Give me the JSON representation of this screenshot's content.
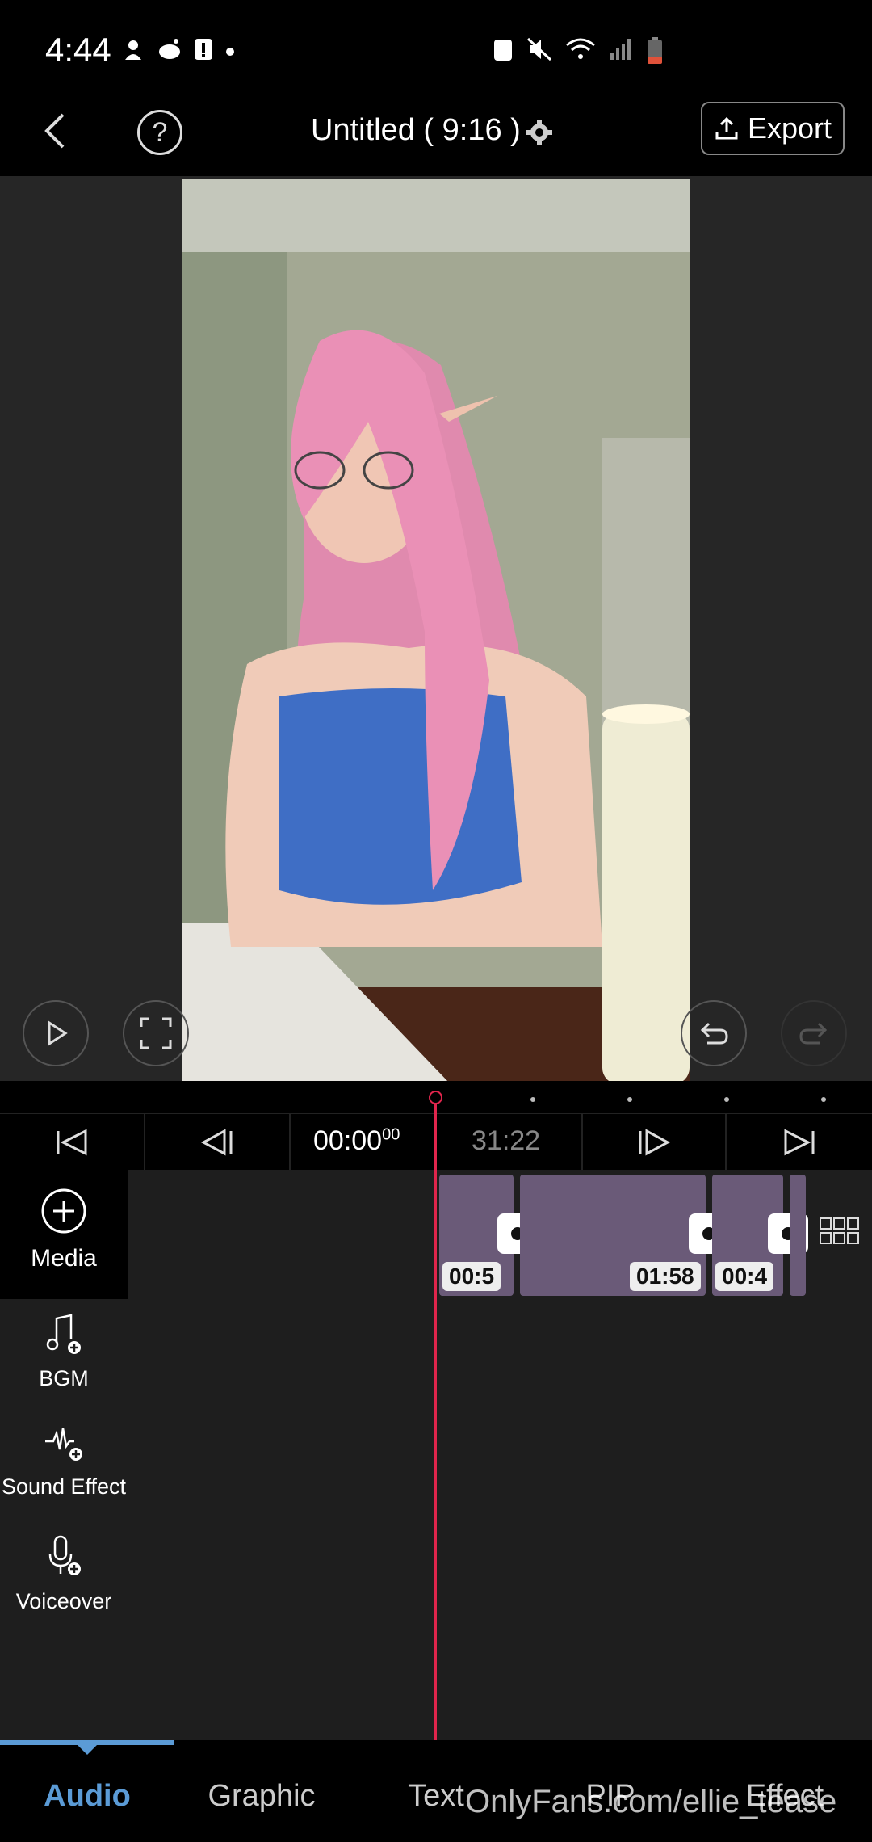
{
  "status": {
    "time": "4:44"
  },
  "header": {
    "title": "Untitled ( 9:16 )",
    "export_label": "Export"
  },
  "transport": {
    "current_time": "00:00",
    "current_frames": "00",
    "total_time": "31:22"
  },
  "tracks": [
    {
      "label": "Media",
      "icon": "plus-circle-icon"
    },
    {
      "label": "BGM",
      "icon": "music-note-icon"
    },
    {
      "label": "Sound Effect",
      "icon": "waveform-icon"
    },
    {
      "label": "Voiceover",
      "icon": "microphone-icon"
    }
  ],
  "clips": [
    {
      "duration": "00:5"
    },
    {
      "duration": "01:58"
    },
    {
      "duration": "00:4"
    }
  ],
  "tabs": [
    {
      "label": "Audio",
      "active": true
    },
    {
      "label": "Graphic"
    },
    {
      "label": "Text"
    },
    {
      "label": "PIP"
    },
    {
      "label": "Effect"
    }
  ],
  "watermark": "OnlyFans.com/ellie_tease",
  "colors": {
    "accent": "#5b9bd6",
    "playhead": "#e0254c"
  }
}
